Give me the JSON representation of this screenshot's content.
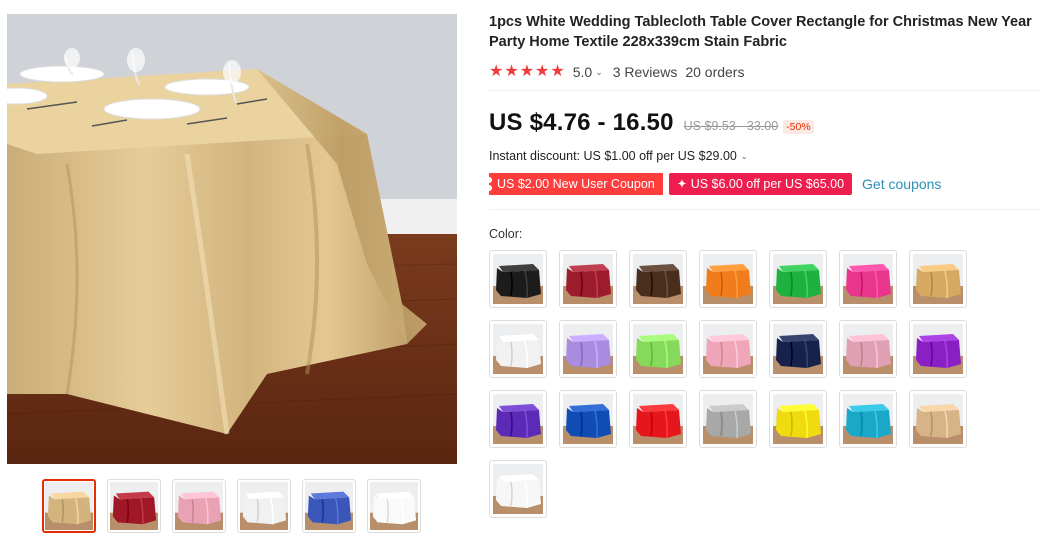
{
  "product": {
    "title": "1pcs White Wedding Tablecloth Table Cover Rectangle for Christmas New Year Party Home Textile 228x339cm Stain Fabric",
    "rating": "5.0",
    "reviews": "3 Reviews",
    "orders": "20 orders",
    "price": "US $4.76 - 16.50",
    "original_price": "US $9.53 - 33.00",
    "discount": "-50%",
    "instant_discount": "Instant discount: US $1.00 off per US $29.00",
    "coupon_new_user": "US $2.00 New User Coupon",
    "coupon_store": "US $6.00 off per US $65.00",
    "get_coupons": "Get coupons",
    "color_label": "Color:"
  },
  "icons": {
    "star": "star-icon",
    "chevron": "chevron-down-icon",
    "coupon_plus": "plus-icon"
  },
  "gallery": {
    "main_color": "#d9bf8a",
    "thumbs": [
      {
        "name": "champagne",
        "color": "#d4b47e"
      },
      {
        "name": "burgundy",
        "color": "#a01828"
      },
      {
        "name": "pink",
        "color": "#e9a2b4"
      },
      {
        "name": "white",
        "color": "#f1f1f1"
      },
      {
        "name": "blue-mix",
        "color": "#3a56b8"
      },
      {
        "name": "white-set",
        "color": "#fafafa"
      }
    ]
  },
  "colors": [
    {
      "name": "black",
      "hex": "#1c1c1c"
    },
    {
      "name": "burgundy",
      "hex": "#9c1b2c"
    },
    {
      "name": "coffee",
      "hex": "#4a2e1d"
    },
    {
      "name": "orange",
      "hex": "#f07c1c"
    },
    {
      "name": "green",
      "hex": "#1fb13f"
    },
    {
      "name": "rose",
      "hex": "#e8368c"
    },
    {
      "name": "gold",
      "hex": "#d6a861"
    },
    {
      "name": "white",
      "hex": "#f1f1f1"
    },
    {
      "name": "lavender",
      "hex": "#a98be0"
    },
    {
      "name": "lime",
      "hex": "#86d95a"
    },
    {
      "name": "light-pink",
      "hex": "#efa6b8"
    },
    {
      "name": "navy",
      "hex": "#17224a"
    },
    {
      "name": "dusty-pink",
      "hex": "#e0a0b4"
    },
    {
      "name": "purple",
      "hex": "#8a1fc4"
    },
    {
      "name": "violet",
      "hex": "#5b2bb5"
    },
    {
      "name": "royal-blue",
      "hex": "#0f4db5"
    },
    {
      "name": "red",
      "hex": "#e6171c"
    },
    {
      "name": "silver",
      "hex": "#a8a8a8"
    },
    {
      "name": "yellow",
      "hex": "#f0da10"
    },
    {
      "name": "turquoise",
      "hex": "#1aa8c8"
    },
    {
      "name": "champagne",
      "hex": "#d6b487"
    },
    {
      "name": "snow-white",
      "hex": "#f7f7f7"
    }
  ]
}
